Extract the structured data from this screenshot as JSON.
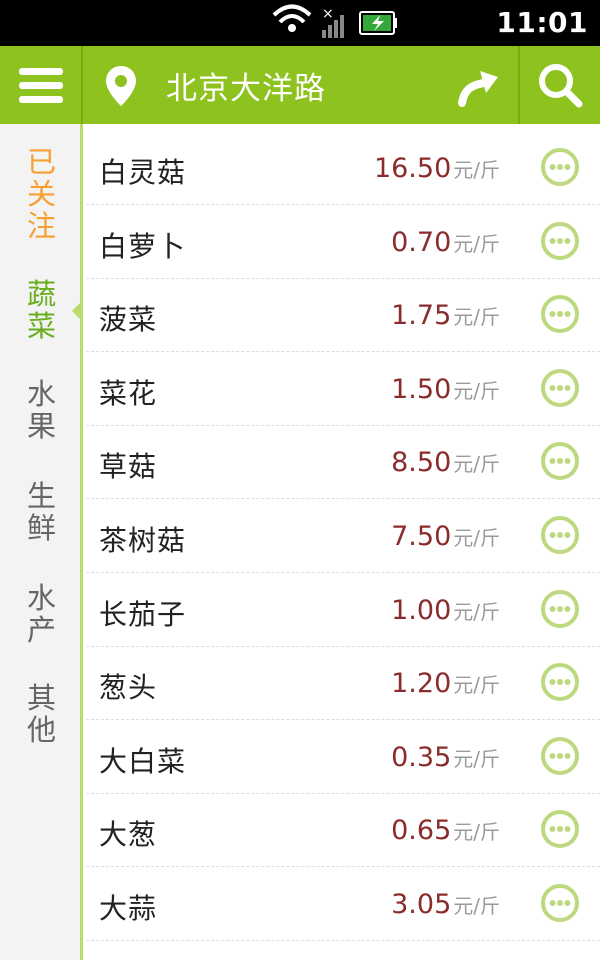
{
  "status_bar": {
    "time": "11:01"
  },
  "header": {
    "location": "北京大洋路",
    "icons": [
      "menu-icon",
      "location-pin-icon",
      "route-icon",
      "search-icon"
    ]
  },
  "sidebar": {
    "categories": [
      {
        "label": [
          "已",
          "关",
          "注"
        ],
        "state": "followed"
      },
      {
        "label": [
          "蔬",
          "菜"
        ],
        "state": "active"
      },
      {
        "label": [
          "水",
          "果"
        ],
        "state": "normal"
      },
      {
        "label": [
          "生",
          "鲜"
        ],
        "state": "normal"
      },
      {
        "label": [
          "水",
          "产"
        ],
        "state": "normal"
      },
      {
        "label": [
          "其",
          "他"
        ],
        "state": "normal"
      }
    ]
  },
  "items": [
    {
      "name": "白灵菇",
      "price": "16.50",
      "unit": "元/斤"
    },
    {
      "name": "白萝卜",
      "price": "0.70",
      "unit": "元/斤"
    },
    {
      "name": "菠菜",
      "price": "1.75",
      "unit": "元/斤"
    },
    {
      "name": "菜花",
      "price": "1.50",
      "unit": "元/斤"
    },
    {
      "name": "草菇",
      "price": "8.50",
      "unit": "元/斤"
    },
    {
      "name": "茶树菇",
      "price": "7.50",
      "unit": "元/斤"
    },
    {
      "name": "长茄子",
      "price": "1.00",
      "unit": "元/斤"
    },
    {
      "name": "葱头",
      "price": "1.20",
      "unit": "元/斤"
    },
    {
      "name": "大白菜",
      "price": "0.35",
      "unit": "元/斤"
    },
    {
      "name": "大葱",
      "price": "0.65",
      "unit": "元/斤"
    },
    {
      "name": "大蒜",
      "price": "3.05",
      "unit": "元/斤"
    }
  ],
  "colors": {
    "accent": "#8dc21f",
    "price": "#8a2c2c",
    "followed": "#f5a031",
    "active_category": "#6aae1f"
  }
}
